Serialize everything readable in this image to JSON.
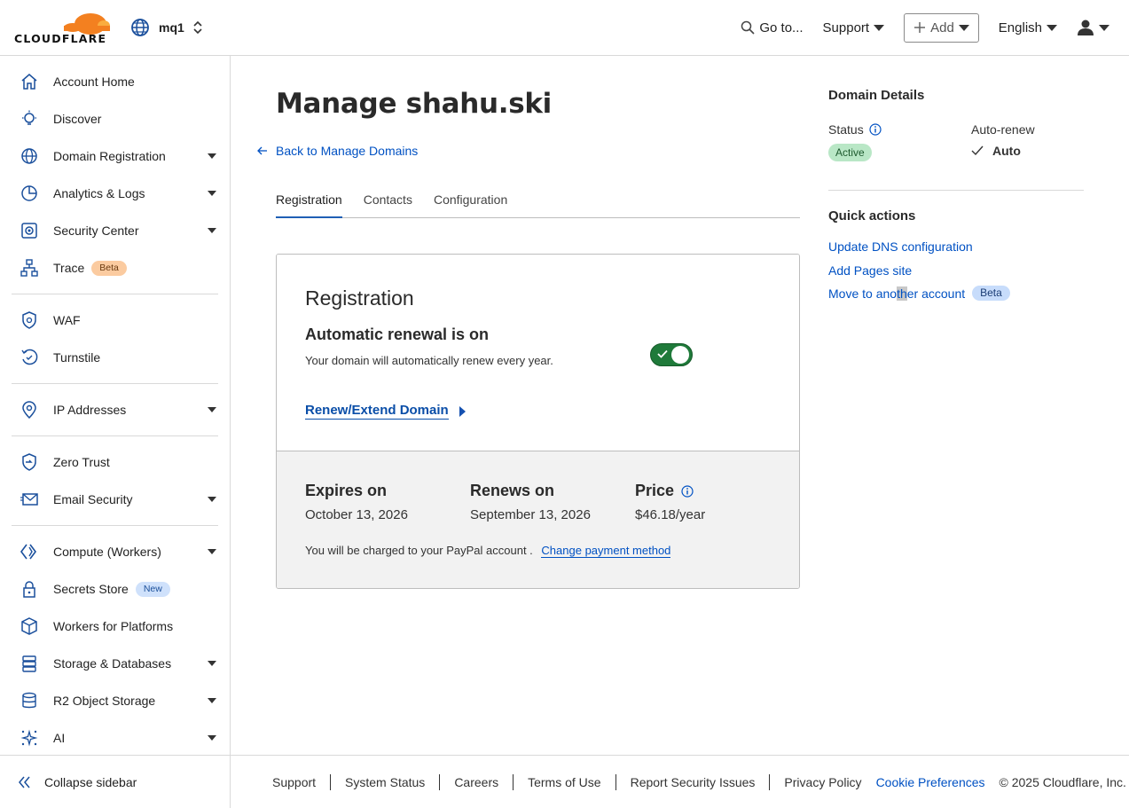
{
  "header": {
    "logo_text": "CLOUDFLARE",
    "account_name": "mq1",
    "goto_label": "Go to...",
    "support_label": "Support",
    "add_label": "Add",
    "language_label": "English"
  },
  "sidebar": {
    "items": [
      {
        "label": "Account Home",
        "icon": "home-icon"
      },
      {
        "label": "Discover",
        "icon": "lightbulb-icon"
      },
      {
        "label": "Domain Registration",
        "icon": "globe-icon",
        "has_caret": true
      },
      {
        "label": "Analytics & Logs",
        "icon": "pie-chart-icon",
        "has_caret": true
      },
      {
        "label": "Security Center",
        "icon": "security-center-icon",
        "has_caret": true
      },
      {
        "label": "Trace",
        "icon": "trace-icon",
        "badge": "Beta"
      },
      {
        "label": "WAF",
        "icon": "waf-icon"
      },
      {
        "label": "Turnstile",
        "icon": "turnstile-icon"
      },
      {
        "label": "IP Addresses",
        "icon": "location-pin-icon",
        "has_caret": true
      },
      {
        "label": "Zero Trust",
        "icon": "zero-trust-icon"
      },
      {
        "label": "Email Security",
        "icon": "email-icon",
        "has_caret": true
      },
      {
        "label": "Compute (Workers)",
        "icon": "workers-icon",
        "has_caret": true
      },
      {
        "label": "Secrets Store",
        "icon": "lock-icon",
        "badge": "New"
      },
      {
        "label": "Workers for Platforms",
        "icon": "cube-icon"
      },
      {
        "label": "Storage & Databases",
        "icon": "storage-icon",
        "has_caret": true
      },
      {
        "label": "R2 Object Storage",
        "icon": "database-icon",
        "has_caret": true
      },
      {
        "label": "AI",
        "icon": "ai-sparkle-icon",
        "has_caret": true
      }
    ],
    "collapse_label": "Collapse sidebar"
  },
  "main": {
    "title": "Manage shahu.ski",
    "back_link": "Back to Manage Domains",
    "tabs": [
      {
        "label": "Registration",
        "active": true
      },
      {
        "label": "Contacts",
        "active": false
      },
      {
        "label": "Configuration",
        "active": false
      }
    ],
    "card": {
      "title": "Registration",
      "renew_title": "Automatic renewal is on",
      "renew_desc": "Your domain will automatically renew every year.",
      "renew_link": "Renew/Extend Domain",
      "toggle_on": true,
      "expires_label": "Expires on",
      "expires_value": "October 13, 2026",
      "renews_label": "Renews on",
      "renews_value": "September 13, 2026",
      "price_label": "Price",
      "price_value": "$46.18/year",
      "charge_text": "You will be charged to your PayPal account .",
      "change_payment": "Change payment method"
    }
  },
  "right_panel": {
    "title": "Domain Details",
    "status_label": "Status",
    "status_value": "Active",
    "autorenew_label": "Auto-renew",
    "autorenew_value": "Auto",
    "quick_actions_title": "Quick actions",
    "quick_actions": [
      {
        "label": "Update DNS configuration"
      },
      {
        "label": "Add Pages site"
      },
      {
        "label_pre": "Move to ano",
        "label_hl": "th",
        "label_post": "er account",
        "badge": "Beta"
      }
    ]
  },
  "footer": {
    "links": [
      "Support",
      "System Status",
      "Careers",
      "Terms of Use",
      "Report Security Issues",
      "Privacy Policy"
    ],
    "cookie_label": "Cookie Preferences",
    "copyright": "© 2025 Cloudflare, Inc."
  },
  "colors": {
    "brand_orange": "#f38020",
    "link_blue": "#0051c3",
    "toggle_green": "#1f7a3a",
    "active_badge": "#b9e7c6"
  }
}
